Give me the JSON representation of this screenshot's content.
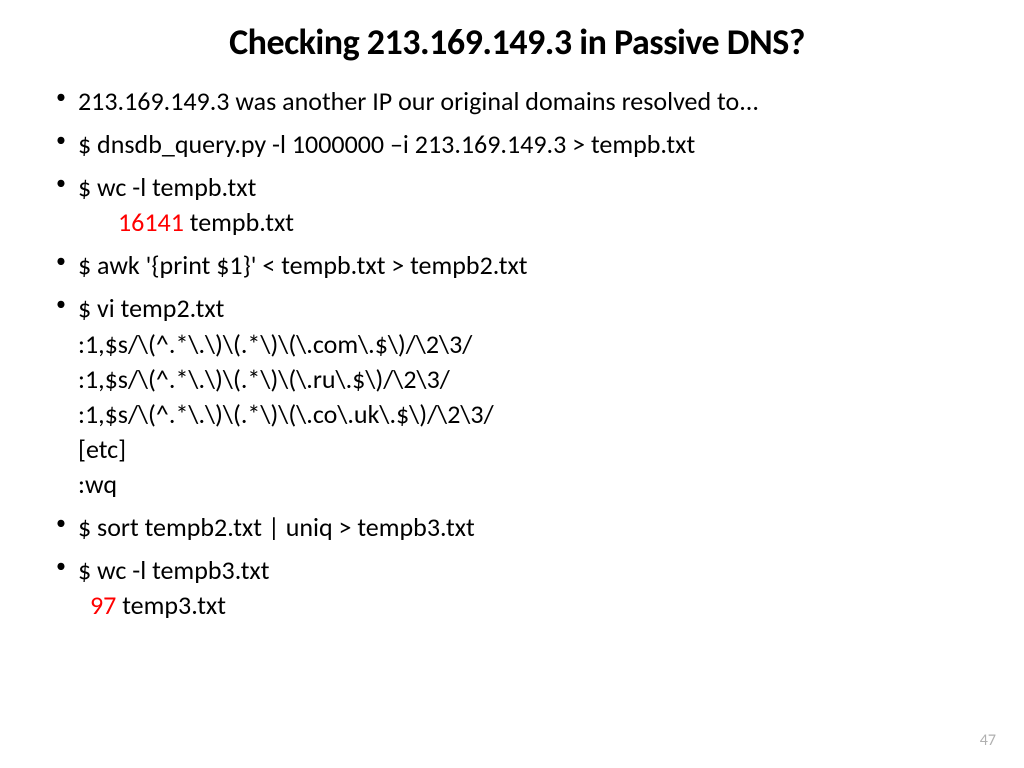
{
  "title": "Checking 213.169.149.3 in Passive DNS?",
  "bullets": {
    "b1": "213.169.149.3 was another IP our original domains resolved to...",
    "b2": "$ dnsdb_query.py -l 1000000 –i 213.169.149.3 > tempb.txt",
    "b3": "$ wc -l tempb.txt",
    "b3_val": "16141",
    "b3_file": " tempb.txt",
    "b4": "$ awk '{print $1}' < tempb.txt > tempb2.txt",
    "b5": "$ vi temp2.txt",
    "b5_l1": ":1,$s/\\(^.*\\.\\)\\(.*\\)\\(\\.com\\.$\\)/\\2\\3/",
    "b5_l2": ":1,$s/\\(^.*\\.\\)\\(.*\\)\\(\\.ru\\.$\\)/\\2\\3/",
    "b5_l3": ":1,$s/\\(^.*\\.\\)\\(.*\\)\\(\\.co\\.uk\\.$\\)/\\2\\3/",
    "b5_l4": "[etc]",
    "b5_l5": ":wq",
    "b6": "$ sort tempb2.txt | uniq > tempb3.txt",
    "b7": "$ wc -l tempb3.txt",
    "b7_val": "97",
    "b7_file": " temp3.txt"
  },
  "page_number": "47"
}
